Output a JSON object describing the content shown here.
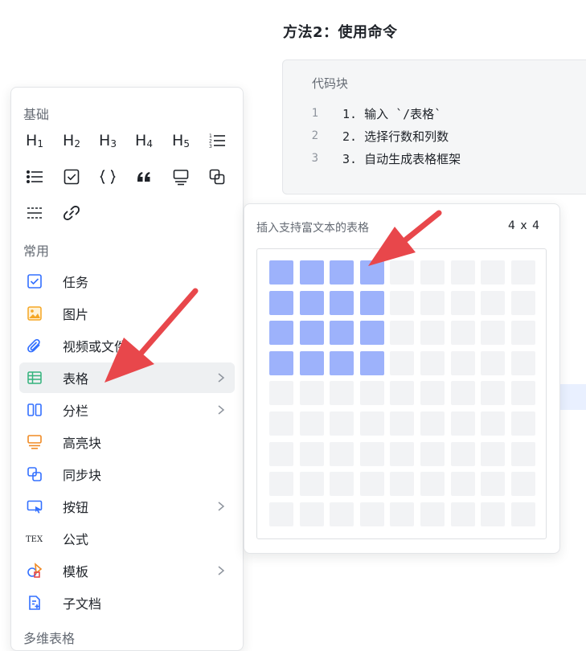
{
  "document": {
    "heading": "方法2：使用命令",
    "code_block": {
      "title": "代码块",
      "lines": [
        {
          "number": "1",
          "text": "1. 输入 `/表格`"
        },
        {
          "number": "2",
          "text": "2. 选择行数和列数"
        },
        {
          "number": "3",
          "text": "3. 自动生成表格框架"
        }
      ]
    }
  },
  "menu": {
    "sections": {
      "basic": "基础",
      "common": "常用",
      "multidim": "多维表格"
    },
    "basic_icons": [
      "heading-1-icon",
      "heading-2-icon",
      "heading-3-icon",
      "heading-4-icon",
      "heading-5-icon",
      "ordered-list-icon",
      "bullet-list-icon",
      "checkbox-icon",
      "code-braces-icon",
      "quote-icon",
      "callout-icon",
      "sync-block-icon",
      "divider-icon",
      "link-icon"
    ],
    "items": [
      {
        "label": "任务",
        "icon": "task-checkbox-icon",
        "has_submenu": false
      },
      {
        "label": "图片",
        "icon": "image-icon",
        "has_submenu": false
      },
      {
        "label": "视频或文件",
        "icon": "paperclip-icon",
        "has_submenu": false
      },
      {
        "label": "表格",
        "icon": "table-icon",
        "has_submenu": true,
        "active": true
      },
      {
        "label": "分栏",
        "icon": "columns-icon",
        "has_submenu": true
      },
      {
        "label": "高亮块",
        "icon": "highlight-block-icon",
        "has_submenu": false
      },
      {
        "label": "同步块",
        "icon": "sync-block-icon",
        "has_submenu": false
      },
      {
        "label": "按钮",
        "icon": "button-icon",
        "has_submenu": true
      },
      {
        "label": "公式",
        "icon": "tex-icon",
        "has_submenu": false
      },
      {
        "label": "模板",
        "icon": "template-icon",
        "has_submenu": true
      },
      {
        "label": "子文档",
        "icon": "subdoc-icon",
        "has_submenu": false
      }
    ]
  },
  "table_picker": {
    "title": "插入支持富文本的表格",
    "size_label": "4 x 4",
    "rows": 9,
    "cols": 9,
    "selected_rows": 4,
    "selected_cols": 4
  },
  "colors": {
    "selected_cell": "#9db2fb",
    "empty_cell": "#f2f3f5",
    "annotation_arrow": "#e8474b",
    "accent_blue": "#3370ff",
    "accent_orange": "#f5a623"
  },
  "glyphs": {
    "tex": "TEX"
  }
}
